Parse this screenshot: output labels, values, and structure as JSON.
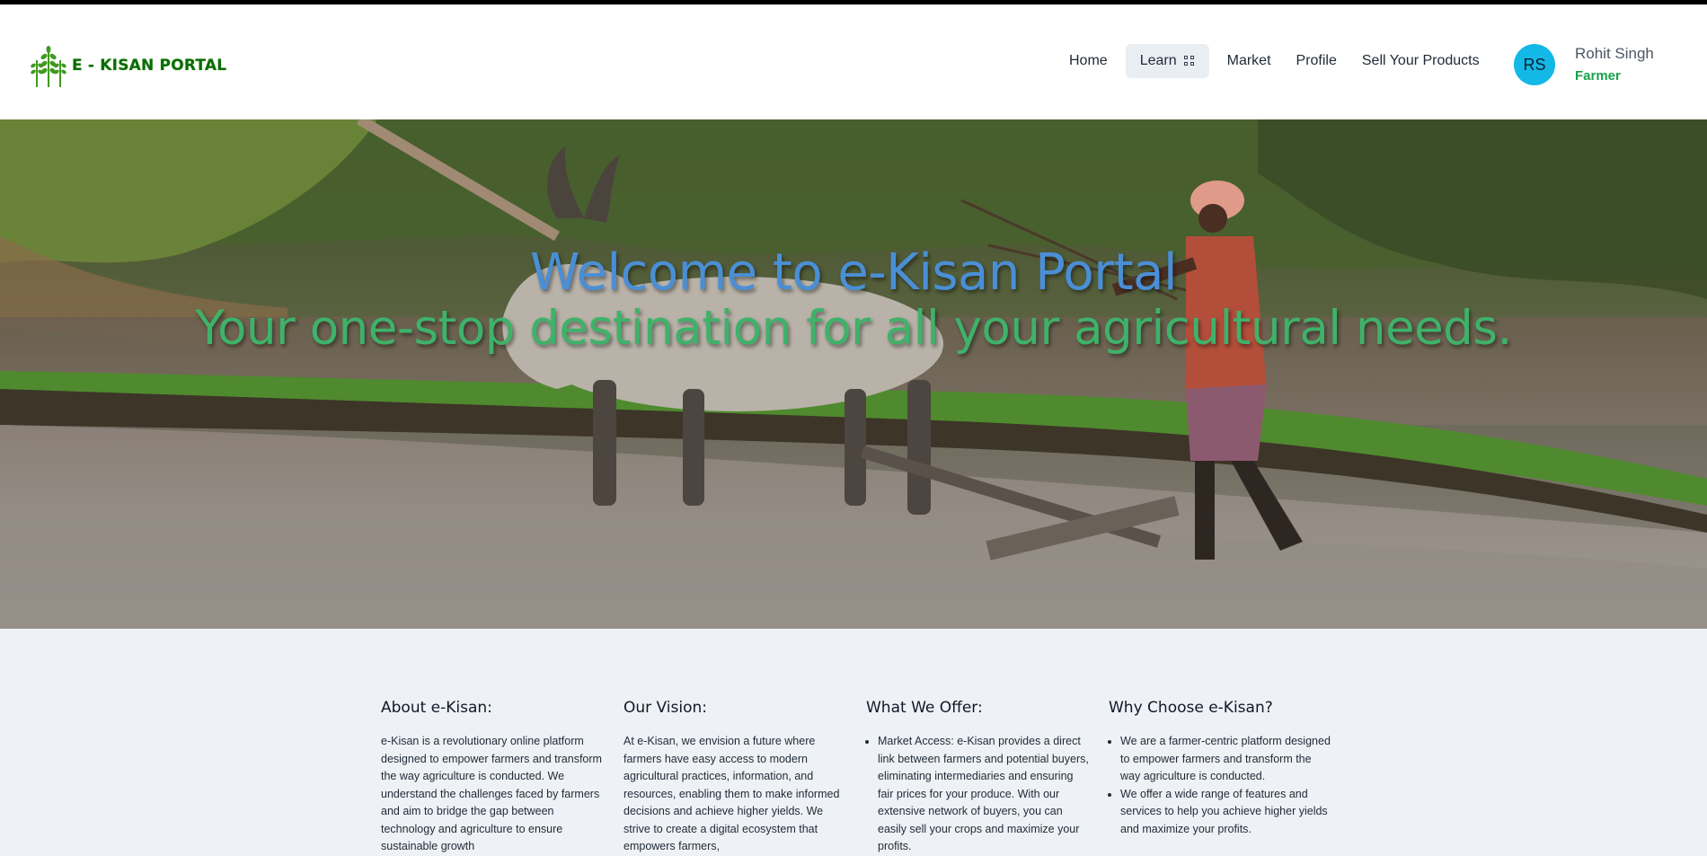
{
  "header": {
    "logo_text": "E - KISAN PORTAL",
    "nav": [
      {
        "label": "Home"
      },
      {
        "label": "Learn"
      },
      {
        "label": "Market"
      },
      {
        "label": "Profile"
      },
      {
        "label": "Sell Your Products"
      }
    ],
    "user": {
      "initials": "RS",
      "name": "Rohit Singh",
      "role": "Farmer"
    }
  },
  "hero": {
    "title": "Welcome to e-Kisan Portal",
    "subtitle": "Your one-stop destination for all your agricultural needs.",
    "image_icon": "farmer-plowing-with-oxen-photo"
  },
  "sections": [
    {
      "heading": "About e-Kisan:",
      "type": "paragraph",
      "text": "e-Kisan is a revolutionary online platform designed to empower farmers and transform the way agriculture is conducted. We understand the challenges faced by farmers and aim to bridge the gap between technology and agriculture to ensure sustainable growth"
    },
    {
      "heading": "Our Vision:",
      "type": "paragraph",
      "text": "At e-Kisan, we envision a future where farmers have easy access to modern agricultural practices, information, and resources, enabling them to make informed decisions and achieve higher yields. We strive to create a digital ecosystem that empowers farmers,"
    },
    {
      "heading": "What We Offer:",
      "type": "list",
      "items": [
        "Market Access: e-Kisan provides a direct link between farmers and potential buyers, eliminating intermediaries and ensuring fair prices for your produce. With our extensive network of buyers, you can easily sell your crops and maximize your profits."
      ]
    },
    {
      "heading": "Why Choose e-Kisan?",
      "type": "list",
      "items": [
        "We are a farmer-centric platform designed to empower farmers and transform the way agriculture is conducted.",
        "We offer a wide range of features and services to help you achieve higher yields and maximize your profits."
      ]
    }
  ],
  "colors": {
    "brand_green": "#0c6b0c",
    "hero_title": "#4a8fd6",
    "hero_subtitle": "#3fb26a",
    "avatar_bg": "#14b8e6",
    "role_green": "#16a34a"
  }
}
